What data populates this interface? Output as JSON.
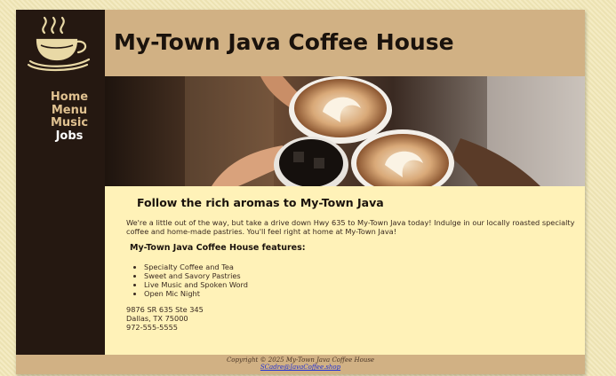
{
  "site": {
    "title": "My-Town Java Coffee House"
  },
  "nav": {
    "items": [
      {
        "label": "Home"
      },
      {
        "label": "Menu"
      },
      {
        "label": "Music"
      },
      {
        "label": "Jobs"
      }
    ]
  },
  "main": {
    "heading": "Follow the rich aromas to My-Town Java",
    "intro": "We're a little out of the way, but take a drive down Hwy 635 to My-Town Java today! Indulge in our locally roasted specialty coffee and home-made pastries. You'll feel right at home at My-Town Java!",
    "features_heading": "My-Town Java Coffee House features:",
    "features": [
      "Specialty Coffee and Tea",
      "Sweet and Savory Pastries",
      "Live Music and Spoken Word",
      "Open Mic Night"
    ],
    "address": {
      "street": "9876 SR 635 Ste 345",
      "city": "Dallas, TX 75000",
      "phone": "972-555-5555"
    }
  },
  "footer": {
    "copyright": "Copyright © 2025 My-Town Java Coffee House",
    "email": "SCadre@JavaCoffee.shop"
  },
  "colors": {
    "sidebar": "#251811",
    "header": "#d1b184",
    "content_bg": "#fff2b8",
    "nav_link": "#e0c190",
    "nav_current": "#ffffff"
  },
  "icons": {
    "logo": "steaming-coffee-cup-icon"
  }
}
